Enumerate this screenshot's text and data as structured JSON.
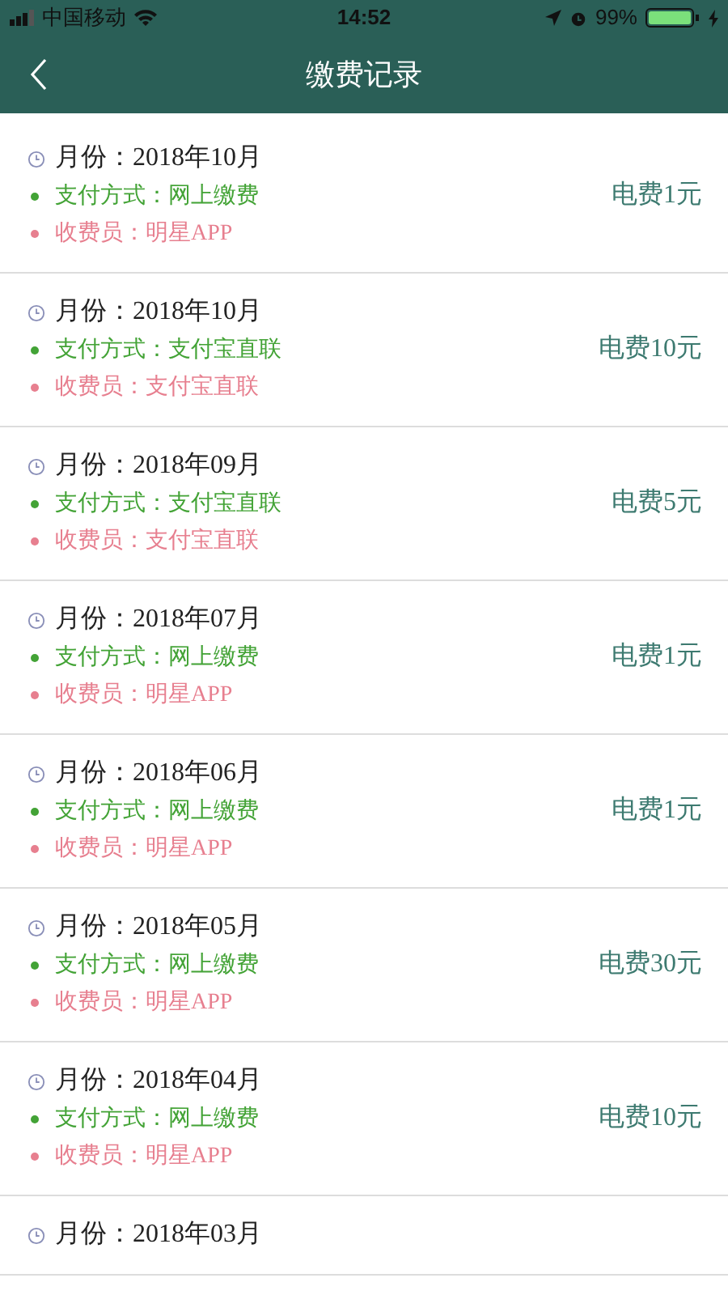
{
  "status_bar": {
    "carrier": "中国移动",
    "time": "14:52",
    "battery": "99%"
  },
  "nav": {
    "title": "缴费记录"
  },
  "records": [
    {
      "month": "月份：2018年10月",
      "method": "支付方式：网上缴费",
      "collector": "收费员：明星APP",
      "amount": "电费1元"
    },
    {
      "month": "月份：2018年10月",
      "method": "支付方式：支付宝直联",
      "collector": "收费员：支付宝直联",
      "amount": "电费10元"
    },
    {
      "month": "月份：2018年09月",
      "method": "支付方式：支付宝直联",
      "collector": "收费员：支付宝直联",
      "amount": "电费5元"
    },
    {
      "month": "月份：2018年07月",
      "method": "支付方式：网上缴费",
      "collector": "收费员：明星APP",
      "amount": "电费1元"
    },
    {
      "month": "月份：2018年06月",
      "method": "支付方式：网上缴费",
      "collector": "收费员：明星APP",
      "amount": "电费1元"
    },
    {
      "month": "月份：2018年05月",
      "method": "支付方式：网上缴费",
      "collector": "收费员：明星APP",
      "amount": "电费30元"
    },
    {
      "month": "月份：2018年04月",
      "method": "支付方式：网上缴费",
      "collector": "收费员：明星APP",
      "amount": "电费10元"
    },
    {
      "month": "月份：2018年03月"
    }
  ]
}
